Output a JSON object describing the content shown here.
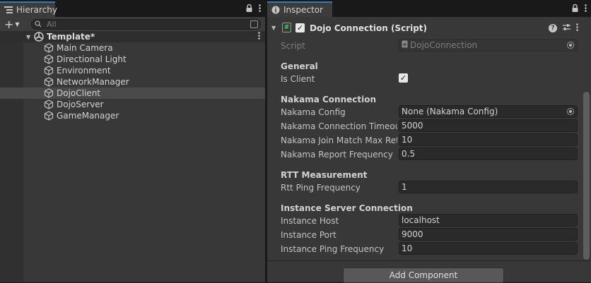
{
  "hierarchy": {
    "tab_label": "Hierarchy",
    "search_placeholder": "All",
    "scene_name": "Template*",
    "objects": [
      {
        "label": "Main Camera"
      },
      {
        "label": "Directional Light"
      },
      {
        "label": "Environment"
      },
      {
        "label": "NetworkManager"
      },
      {
        "label": "DojoClient",
        "selected": true
      },
      {
        "label": "DojoServer"
      },
      {
        "label": "GameManager"
      }
    ]
  },
  "inspector": {
    "tab_label": "Inspector",
    "component_title": "Dojo Connection (Script)",
    "script_label": "Script",
    "script_value": "DojoConnection",
    "sections": {
      "general": "General",
      "nakama": "Nakama Connection",
      "rtt": "RTT Measurement",
      "instance": "Instance Server Connection"
    },
    "is_client_label": "Is Client",
    "is_client_checked": true,
    "nakama_config_label": "Nakama Config",
    "nakama_config_value": "None (Nakama Config)",
    "nakama_timeout_label": "Nakama Connection Timeout",
    "nakama_timeout_value": "5000",
    "nakama_retries_label": "Nakama Join Match Max Retri",
    "nakama_retries_value": "10",
    "nakama_report_label": "Nakama Report Frequency",
    "nakama_report_value": "0.5",
    "rtt_ping_label": "Rtt Ping Frequency",
    "rtt_ping_value": "1",
    "instance_host_label": "Instance Host",
    "instance_host_value": "localhost",
    "instance_port_label": "Instance Port",
    "instance_port_value": "9000",
    "instance_ping_label": "Instance Ping Frequency",
    "instance_ping_value": "10",
    "add_component_label": "Add Component"
  },
  "colors": {
    "accent_tab": "#3a79bb",
    "panel_bg": "#383838",
    "field_bg": "#2a2a2a",
    "script_icon": "#40d060"
  }
}
